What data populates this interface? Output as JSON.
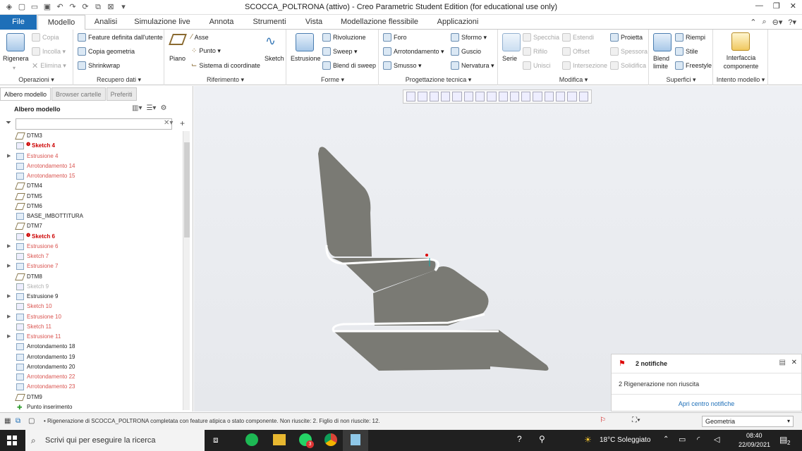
{
  "window": {
    "title": "SCOCCA_POLTRONA (attivo) - Creo Parametric Student Edition (for educational use only)"
  },
  "tabs": [
    "File",
    "Modello",
    "Analisi",
    "Simulazione live",
    "Annota",
    "Strumenti",
    "Vista",
    "Modellazione flessibile",
    "Applicazioni"
  ],
  "ribbon": {
    "operazioni": {
      "label": "Operazioni ▾",
      "rigenera": "Rigenera",
      "copia": "Copia",
      "incolla": "Incolla ▾",
      "elimina": "Elimina ▾"
    },
    "recupero": {
      "label": "Recupero dati ▾",
      "feature": "Feature definita dall'utente",
      "copia_geometria": "Copia geometria",
      "shrinkwrap": "Shrinkwrap"
    },
    "riferimento": {
      "label": "Riferimento ▾",
      "piano": "Piano",
      "asse": "Asse",
      "punto": "Punto ▾",
      "sistema": "Sistema di coordinate",
      "sketch": "Sketch"
    },
    "forme": {
      "label": "Forme ▾",
      "estrusione": "Estrusione",
      "rivoluzione": "Rivoluzione",
      "sweep": "Sweep ▾",
      "blend": "Blend di sweep"
    },
    "progettazione": {
      "label": "Progettazione tecnica ▾",
      "foro": "Foro",
      "arrotondamento": "Arrotondamento ▾",
      "smusso": "Smusso ▾",
      "sformo": "Sformo ▾",
      "guscio": "Guscio",
      "nervatura": "Nervatura ▾"
    },
    "modifica": {
      "label": "Modifica ▾",
      "serie": "Serie",
      "specchia": "Specchia",
      "rifilo": "Rifilo",
      "unisci": "Unisci",
      "estendi": "Estendi",
      "offset": "Offset",
      "intersezione": "Intersezione",
      "proietta": "Proietta",
      "spessora": "Spessora",
      "solidifica": "Solidifica"
    },
    "superfici": {
      "label": "Superfici ▾",
      "blend_limite": "Blend limite",
      "riempi": "Riempi",
      "stile": "Stile",
      "freestyle": "Freestyle"
    },
    "intento": {
      "label": "Intento modello ▾",
      "interfaccia": "Interfaccia componente"
    }
  },
  "panel": {
    "tabs": [
      "Albero modello",
      "Browser cartelle",
      "Preferiti"
    ],
    "heading": "Albero modello"
  },
  "tree": [
    {
      "label": "DTM3",
      "type": "plane",
      "color": "normal"
    },
    {
      "label": "Sketch 4",
      "type": "sketch",
      "color": "error",
      "err": true
    },
    {
      "label": "Estrusione 4",
      "type": "feat",
      "color": "red",
      "arrow": true
    },
    {
      "label": "Arrotondamento 14",
      "type": "feat",
      "color": "red"
    },
    {
      "label": "Arrotondamento 15",
      "type": "feat",
      "color": "red"
    },
    {
      "label": "DTM4",
      "type": "plane",
      "color": "normal"
    },
    {
      "label": "DTM5",
      "type": "plane",
      "color": "normal"
    },
    {
      "label": "DTM6",
      "type": "plane",
      "color": "normal"
    },
    {
      "label": "BASE_IMBOTTITURA",
      "type": "feat",
      "color": "normal"
    },
    {
      "label": "DTM7",
      "type": "plane",
      "color": "normal"
    },
    {
      "label": "Sketch 6",
      "type": "sketch",
      "color": "error",
      "err": true
    },
    {
      "label": "Estrusione 6",
      "type": "feat",
      "color": "red",
      "arrow": true
    },
    {
      "label": "Sketch 7",
      "type": "sketch",
      "color": "red"
    },
    {
      "label": "Estrusione 7",
      "type": "feat",
      "color": "red",
      "arrow": true
    },
    {
      "label": "DTM8",
      "type": "plane",
      "color": "normal"
    },
    {
      "label": "Sketch 9",
      "type": "sketch",
      "color": "grey"
    },
    {
      "label": "Estrusione 9",
      "type": "feat",
      "color": "normal",
      "arrow": true
    },
    {
      "label": "Sketch 10",
      "type": "sketch",
      "color": "red"
    },
    {
      "label": "Estrusione 10",
      "type": "feat",
      "color": "red",
      "arrow": true
    },
    {
      "label": "Sketch 11",
      "type": "sketch",
      "color": "red"
    },
    {
      "label": "Estrusione 11",
      "type": "feat",
      "color": "red",
      "arrow": true
    },
    {
      "label": "Arrotondamento 18",
      "type": "feat",
      "color": "normal"
    },
    {
      "label": "Arrotondamento 19",
      "type": "feat",
      "color": "normal"
    },
    {
      "label": "Arrotondamento 20",
      "type": "feat",
      "color": "normal"
    },
    {
      "label": "Arrotondamento 22",
      "type": "feat",
      "color": "red"
    },
    {
      "label": "Arrotondamento 23",
      "type": "feat",
      "color": "red"
    },
    {
      "label": "DTM9",
      "type": "plane",
      "color": "normal"
    },
    {
      "label": "Punto inserimento",
      "type": "insert",
      "color": "normal"
    }
  ],
  "notifications": {
    "title": "2 notifiche",
    "message": "2 Rigenerazione non riuscita",
    "link": "Apri centro notifiche"
  },
  "status": {
    "message": "• Rigenerazione di SCOCCA_POLTRONA completata con feature atipica o stato componente. Non riuscite: 2. Figlio di non riuscite: 12.",
    "filter": "Geometria"
  },
  "taskbar": {
    "search": "Scrivi qui per eseguire la ricerca",
    "weather": "18°C Soleggiato",
    "time": "08:40",
    "date": "22/09/2021",
    "badge": "3",
    "notif_count": "2"
  },
  "colors": {
    "accent": "#1e6fb8",
    "error": "#cc0000",
    "red_item": "#d9534f",
    "model": "#7a7a74"
  }
}
